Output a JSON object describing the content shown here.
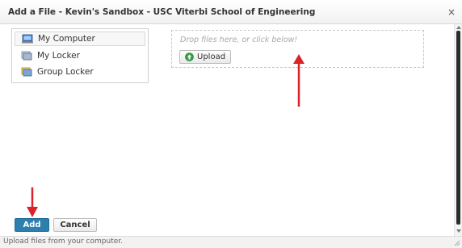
{
  "window": {
    "title": "Add a File - Kevin's Sandbox - USC Viterbi School of Engineering",
    "close_glyph": "×"
  },
  "sidebar": {
    "items": [
      {
        "label": "My Computer",
        "icon": "computer-icon",
        "selected": true
      },
      {
        "label": "My Locker",
        "icon": "locker-icon",
        "selected": false
      },
      {
        "label": "Group Locker",
        "icon": "group-locker-icon",
        "selected": false
      }
    ]
  },
  "dropzone": {
    "hint": "Drop files here, or click below!",
    "upload_label": "Upload"
  },
  "actions": {
    "add_label": "Add",
    "cancel_label": "Cancel"
  },
  "status": {
    "text": "Upload files from your computer."
  },
  "colors": {
    "add_button": "#2d7fae",
    "annotation_arrow": "#d9252a"
  }
}
